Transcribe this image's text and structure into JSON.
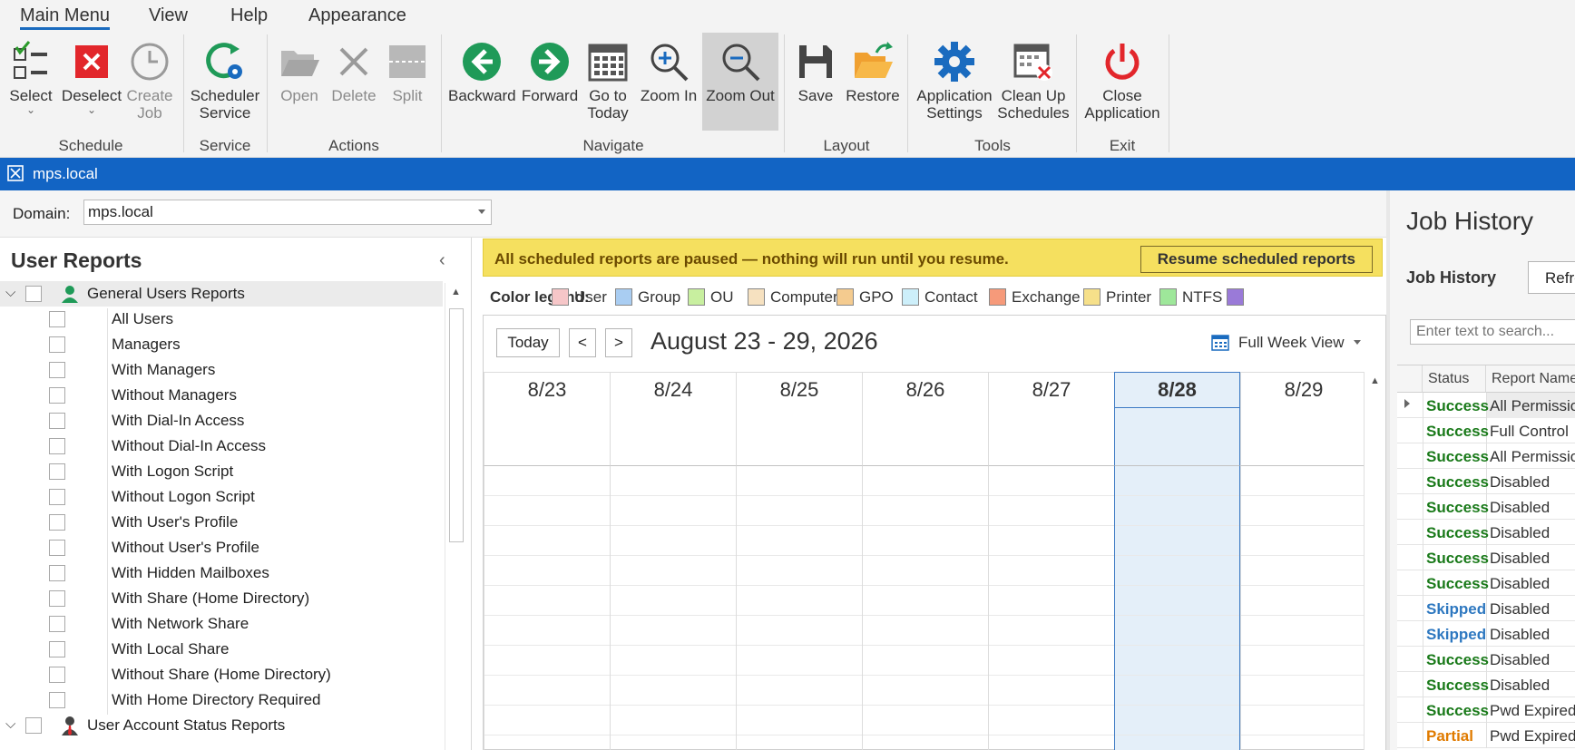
{
  "menu": {
    "items": [
      "Main Menu",
      "View",
      "Help",
      "Appearance"
    ]
  },
  "ribbon": {
    "groups": {
      "schedule": "Schedule",
      "service": "Service",
      "actions": "Actions",
      "navigate": "Navigate",
      "layout": "Layout",
      "tools": "Tools",
      "exit": "Exit"
    },
    "buttons": {
      "select": "Select",
      "deselect": "Deselect",
      "create_job_1": "Create",
      "create_job_2": "Job",
      "scheduler_1": "Scheduler",
      "scheduler_2": "Service",
      "open": "Open",
      "delete": "Delete",
      "split": "Split",
      "backward": "Backward",
      "forward": "Forward",
      "goto_1": "Go to",
      "goto_2": "Today",
      "zoom_in": "Zoom In",
      "zoom_out": "Zoom Out",
      "save": "Save",
      "restore": "Restore",
      "app_settings_1": "Application",
      "app_settings_2": "Settings",
      "cleanup_1": "Clean Up",
      "cleanup_2": "Schedules",
      "close_1": "Close",
      "close_2": "Application"
    }
  },
  "docbar": {
    "title": "mps.local"
  },
  "domain": {
    "label": "Domain:",
    "value": "mps.local"
  },
  "tree": {
    "title": "User Reports",
    "group1": "General Users Reports",
    "items": [
      "All Users",
      "Managers",
      "With Managers",
      "Without Managers",
      "With Dial-In Access",
      "Without Dial-In Access",
      "With Logon Script",
      "Without Logon Script",
      "With User's Profile",
      "Without User's Profile",
      "With Hidden Mailboxes",
      "With Share (Home Directory)",
      "With Network Share",
      "With Local Share",
      "Without Share (Home Directory)",
      "With Home Directory Required"
    ],
    "group2": "User Account Status Reports"
  },
  "notice": {
    "message": "All scheduled reports are paused — nothing will run until you resume.",
    "button": "Resume scheduled reports"
  },
  "legend": {
    "title": "Color legend:",
    "items": [
      {
        "label": "User",
        "color": "#f6c6c8"
      },
      {
        "label": "Group",
        "color": "#a9cdf2"
      },
      {
        "label": "OU",
        "color": "#c8ef9f"
      },
      {
        "label": "Computer",
        "color": "#f6e1c0"
      },
      {
        "label": "GPO",
        "color": "#f4cb8f"
      },
      {
        "label": "Contact",
        "color": "#cdeffa"
      },
      {
        "label": "Exchange",
        "color": "#f69a7a"
      },
      {
        "label": "Printer",
        "color": "#f6e08a"
      },
      {
        "label": "NTFS",
        "color": "#9ee79a"
      },
      {
        "label": "",
        "color": "#9a7ad8"
      }
    ]
  },
  "calendar": {
    "today_button": "Today",
    "prev": "<",
    "next": ">",
    "range": "August 23 - 29, 2026",
    "view": "Full Week View",
    "days": [
      "8/23",
      "8/24",
      "8/25",
      "8/26",
      "8/27",
      "8/28",
      "8/29"
    ],
    "today_index": 5
  },
  "job_history": {
    "title": "Job History",
    "tab": "Job History",
    "refresh": "Refresh",
    "search_placeholder": "Enter text to search...",
    "columns": [
      "Status",
      "Report Name"
    ],
    "status_colors": {
      "Success": "#1a7a1a",
      "Skipped": "#2e78c0",
      "Partial": "#e07b00"
    },
    "rows": [
      {
        "status": "Success",
        "report": "All Permissions"
      },
      {
        "status": "Success",
        "report": "Full Control"
      },
      {
        "status": "Success",
        "report": "All Permissions"
      },
      {
        "status": "Success",
        "report": "Disabled"
      },
      {
        "status": "Success",
        "report": "Disabled"
      },
      {
        "status": "Success",
        "report": "Disabled"
      },
      {
        "status": "Success",
        "report": "Disabled"
      },
      {
        "status": "Success",
        "report": "Disabled"
      },
      {
        "status": "Skipped",
        "report": "Disabled"
      },
      {
        "status": "Skipped",
        "report": "Disabled"
      },
      {
        "status": "Success",
        "report": "Disabled"
      },
      {
        "status": "Success",
        "report": "Disabled"
      },
      {
        "status": "Success",
        "report": "Pwd Expired"
      },
      {
        "status": "Partial",
        "report": "Pwd Expired"
      }
    ]
  }
}
